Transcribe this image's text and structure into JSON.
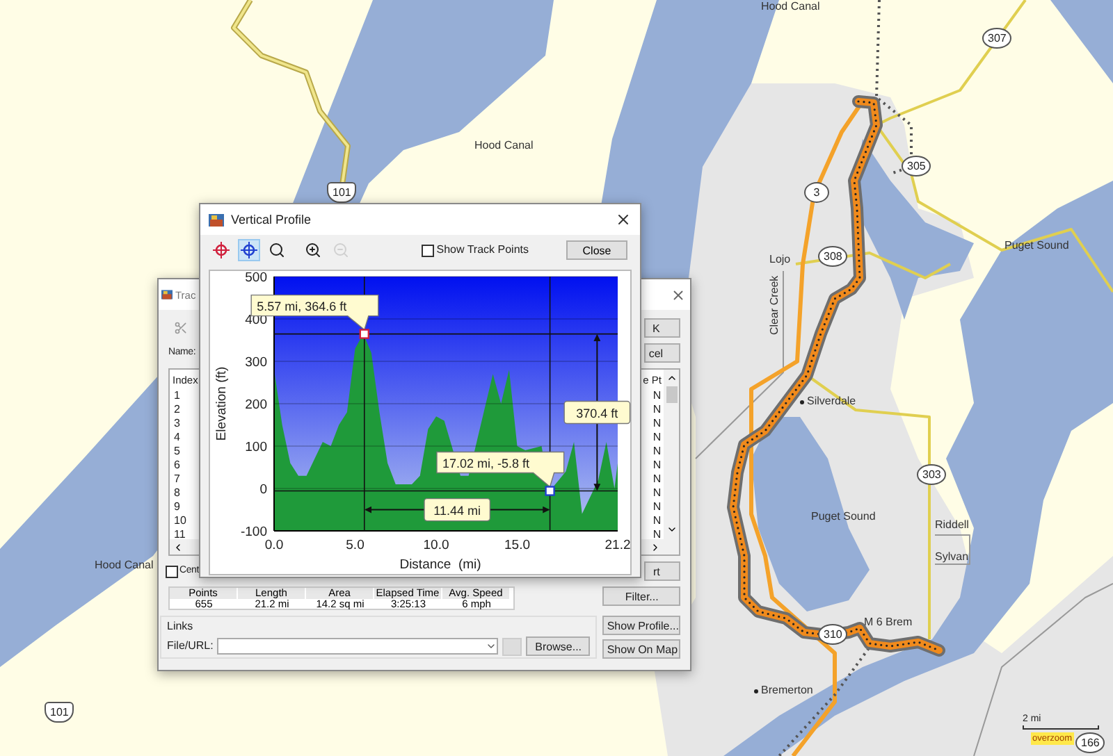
{
  "map": {
    "labels": [
      {
        "text": "Hood Canal",
        "kind": "water"
      },
      {
        "text": "Hood Canal",
        "kind": "water"
      },
      {
        "text": "Puget Sound",
        "kind": "water"
      },
      {
        "text": "Lojo",
        "kind": "road"
      },
      {
        "text": "Clear Creek",
        "kind": "road-vertical"
      },
      {
        "text": "Silverdale",
        "kind": "town"
      },
      {
        "text": "Puget Sound",
        "kind": "water"
      },
      {
        "text": "Riddell",
        "kind": "road"
      },
      {
        "text": "Sylvan",
        "kind": "road"
      },
      {
        "text": "M 6 Brem",
        "kind": "poi"
      },
      {
        "text": "Bremerton",
        "kind": "town"
      },
      {
        "text": "Hood Canal",
        "kind": "water"
      }
    ],
    "shields": [
      {
        "text": "101",
        "kind": "us"
      },
      {
        "text": "307",
        "kind": "state"
      },
      {
        "text": "305",
        "kind": "state"
      },
      {
        "text": "3",
        "kind": "state"
      },
      {
        "text": "308",
        "kind": "state"
      },
      {
        "text": "303",
        "kind": "state"
      },
      {
        "text": "310",
        "kind": "state"
      },
      {
        "text": "101",
        "kind": "us"
      },
      {
        "text": "166",
        "kind": "state"
      }
    ],
    "scale": {
      "label": "2 mi",
      "badge": "overzoom"
    }
  },
  "track_dialog": {
    "title": "Trac",
    "name_label": "Name:",
    "list": {
      "columns": [
        "Index",
        "e",
        "Pt"
      ],
      "rows": [
        {
          "index": "1",
          "pt": "N"
        },
        {
          "index": "2",
          "pt": "N"
        },
        {
          "index": "3",
          "pt": "N"
        },
        {
          "index": "4",
          "pt": "N"
        },
        {
          "index": "5",
          "pt": "N"
        },
        {
          "index": "6",
          "pt": "N"
        },
        {
          "index": "7",
          "pt": "N"
        },
        {
          "index": "8",
          "pt": "N"
        },
        {
          "index": "9",
          "pt": "N"
        },
        {
          "index": "10",
          "pt": "N"
        },
        {
          "index": "11",
          "pt": "N"
        }
      ]
    },
    "center_checkbox": {
      "label": "Cent",
      "checked": false
    },
    "stats": {
      "columns": [
        "Points",
        "Length",
        "Area",
        "Elapsed Time",
        "Avg. Speed"
      ],
      "values": [
        "655",
        "21.2 mi",
        "14.2 sq mi",
        "3:25:13",
        "6 mph"
      ]
    },
    "links": {
      "title": "Links",
      "field_label": "File/URL:",
      "browse": "Browse..."
    },
    "buttons": [
      {
        "label": "K",
        "kind": "cut"
      },
      {
        "label": "cel",
        "kind": "cut"
      },
      {
        "label": "rt",
        "kind": "cut"
      },
      {
        "label": "Filter...",
        "kind": "full"
      },
      {
        "label": "Show Profile...",
        "kind": "full"
      },
      {
        "label": "Show On Map",
        "kind": "full"
      }
    ]
  },
  "profile_window": {
    "title": "Vertical Profile",
    "tools": [
      {
        "kind": "point-a",
        "selected": false,
        "disabled": false
      },
      {
        "kind": "point-b",
        "selected": true,
        "disabled": false
      },
      {
        "kind": "zoom-area",
        "selected": false,
        "disabled": false
      },
      {
        "kind": "zoom-in",
        "selected": false,
        "disabled": false
      },
      {
        "kind": "zoom-out",
        "selected": false,
        "disabled": true
      }
    ],
    "show_track_points": {
      "label": "Show Track Points",
      "checked": false
    },
    "close": "Close",
    "chart_data": {
      "type": "area",
      "xlabel": "Distance  (mi)",
      "ylabel": "Elevation (ft)",
      "grid": true,
      "x": [
        0,
        0.5,
        1,
        1.5,
        2,
        2.5,
        3,
        3.5,
        4,
        4.5,
        5,
        5.5,
        6,
        6.5,
        7,
        7.5,
        8,
        8.5,
        9,
        9.5,
        10,
        10.5,
        11,
        11.5,
        12,
        12.5,
        13,
        13.5,
        14,
        14.5,
        15,
        15.5,
        16,
        16.5,
        17,
        17.5,
        18,
        18.5,
        19,
        19.5,
        20,
        20.5,
        21,
        21.2
      ],
      "series": [
        {
          "color": "#1f9a3a",
          "values": [
            280,
            150,
            60,
            30,
            30,
            70,
            110,
            100,
            150,
            180,
            330,
            365,
            320,
            180,
            60,
            10,
            10,
            10,
            30,
            140,
            170,
            160,
            null,
            30,
            30,
            null,
            null,
            270,
            200,
            280,
            100,
            90,
            null,
            100,
            -6,
            null,
            40,
            110,
            -60,
            -20,
            20,
            110,
            0,
            60
          ]
        }
      ],
      "xlim": [
        0,
        21.2
      ],
      "ylim": [
        -100,
        500
      ],
      "xticks": [
        {
          "value": 0,
          "label": "0.0"
        },
        {
          "value": 5,
          "label": "5.0"
        },
        {
          "value": 10,
          "label": "10.0"
        },
        {
          "value": 15,
          "label": "15.0"
        },
        {
          "value": 21.2,
          "label": "21.2"
        }
      ],
      "yticks": [
        -100,
        0,
        100,
        200,
        300,
        400,
        500
      ],
      "annotations": [
        {
          "text": "5.57 mi, 364.6 ft",
          "x": 5.57,
          "y": 364.6
        },
        {
          "text": "17.02 mi, -5.8 ft",
          "x": 17.02,
          "y": -5.8
        },
        "11.44 mi",
        "370.4 ft"
      ]
    }
  }
}
